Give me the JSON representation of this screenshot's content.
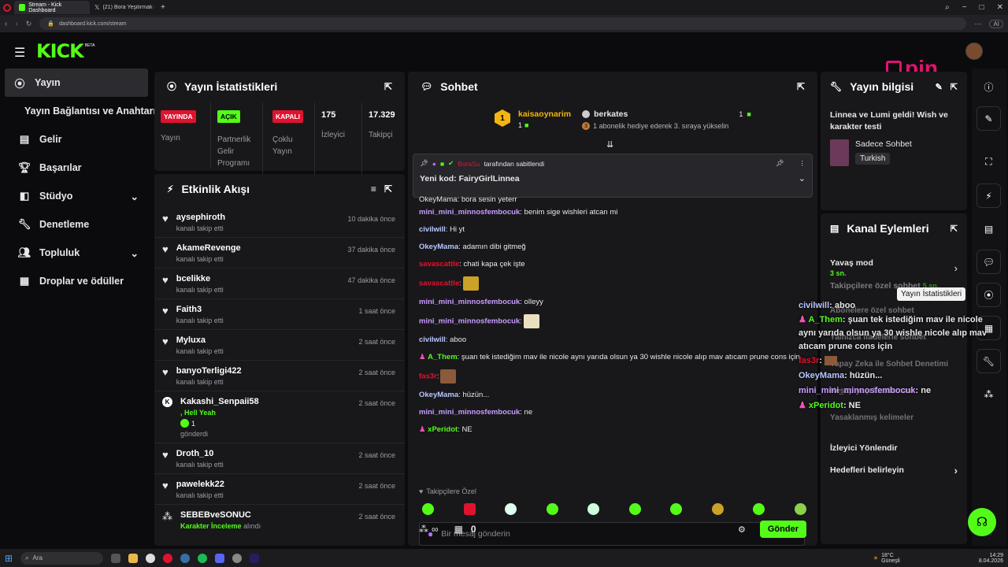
{
  "browser": {
    "tabs": [
      {
        "label": "Stream - Kick Dashboard"
      },
      {
        "label": "(21) Bora Yeşilırmak (@Bo"
      }
    ],
    "url": "dashboard.kick.com/stream"
  },
  "header": {
    "logo": "KICK",
    "logo_tag": "BETA",
    "watermark": "pin"
  },
  "sidebar": {
    "items": [
      {
        "label": "Yayın",
        "icon": "broadcast-icon"
      },
      {
        "label": "Yayın Bağlantısı ve Anahtarı"
      },
      {
        "label": "Gelir",
        "icon": "chart-icon"
      },
      {
        "label": "Başarılar",
        "icon": "trophy-icon"
      },
      {
        "label": "Stüdyo",
        "icon": "studio-icon"
      },
      {
        "label": "Denetleme",
        "icon": "wrench-icon"
      },
      {
        "label": "Topluluk",
        "icon": "community-icon"
      },
      {
        "label": "Droplar ve ödüller",
        "icon": "drops-icon"
      }
    ]
  },
  "stats": {
    "title": "Yayın İstatistikleri",
    "cols": [
      {
        "badge": "YAYINDA",
        "label": "Yayın",
        "color": "#e0132f"
      },
      {
        "badge": "AÇIK",
        "label": "Partnerlik Gelir Programı",
        "color": "#53fc18"
      },
      {
        "badge": "KAPALI",
        "label": "Çoklu Yayın",
        "color": "#e0132f"
      },
      {
        "value": "175",
        "label": "İzleyici"
      },
      {
        "value": "17.329",
        "label": "Takipçi"
      }
    ]
  },
  "activity": {
    "title": "Etkinlik Akışı",
    "items": [
      {
        "name": "aysephiroth",
        "sub": "kanalı takip etti",
        "time": "10 dakika önce"
      },
      {
        "name": "AkameRevenge",
        "sub": "kanalı takip etti",
        "time": "37 dakika önce"
      },
      {
        "name": "bcelikke",
        "sub": "kanalı takip etti",
        "time": "47 dakika önce"
      },
      {
        "name": "Faith3",
        "sub": "kanalı takip etti",
        "time": "1 saat önce"
      },
      {
        "name": "Myluxa",
        "sub": "kanalı takip etti",
        "time": "2 saat önce"
      },
      {
        "name": "banyoTerligi422",
        "sub": "kanalı takip etti",
        "time": "2 saat önce"
      },
      {
        "name": "Kakashi_Senpaii58",
        "msg": ", Hell Yeah",
        "count": "1",
        "sub": "gönderdi",
        "time": "2 saat önce"
      },
      {
        "name": "Droth_10",
        "sub": "kanalı takip etti",
        "time": "2 saat önce"
      },
      {
        "name": "pawelekk22",
        "sub": "kanalı takip etti",
        "time": "2 saat önce"
      },
      {
        "name": "SEBEBveSONUC",
        "reward": "Karakter İnceleme",
        "sub": "alındı",
        "time": "2 saat önce"
      }
    ]
  },
  "chat": {
    "title": "Sohbet",
    "top_gifter": {
      "name": "kaisaoynarim",
      "count": "1",
      "rank": "1"
    },
    "second": {
      "name": "berkates",
      "count": "1",
      "note": "1 abonelik hediye ederek 3. sıraya yükselin",
      "rank": "3"
    },
    "pinned": {
      "by_user": "BoraSu",
      "by_text": "tarafından sabitlendi",
      "text": "Yeni kod: FairyGirlLinnea"
    },
    "cut_line": "OkeyMama: bora sesin yeterr",
    "messages": [
      {
        "user": "mini_mini_minnosfembocuk",
        "color": "#c99cff",
        "text": ": benim sige wishleri atcan mi"
      },
      {
        "user": "civilwill",
        "color": "#b7c7ff",
        "text": ": Hi yt"
      },
      {
        "user": "OkeyMama",
        "color": "#b7c7ff",
        "text": ": adamın dibi gitmeğ"
      },
      {
        "user": "savascattle",
        "color": "#e0132f",
        "text": ": chati kapa çek işte"
      },
      {
        "user": "savascattle",
        "color": "#e0132f",
        "text": ":",
        "emote": "#c9a227"
      },
      {
        "user": "mini_mini_minnosfembocuk",
        "color": "#c99cff",
        "text": ": olleyy"
      },
      {
        "user": "mini_mini_minnosfembocuk",
        "color": "#c99cff",
        "text": ":",
        "emote": "#e8e0c0"
      },
      {
        "user": "civilwill",
        "color": "#b7c7ff",
        "text": ": aboo"
      },
      {
        "user": "A_Them",
        "color": "#53fc18",
        "text": ": şuan tek istediğim mav ile nicole aynı yarıda olsun ya 30 wishle nicole alıp mav atıcam prune cons için",
        "badge": true
      },
      {
        "user": "fas3r",
        "color": "#e0132f",
        "text": ":",
        "emote": "#8a5a3a"
      },
      {
        "user": "OkeyMama",
        "color": "#b7c7ff",
        "text": ": hüzün..."
      },
      {
        "user": "mini_mini_minnosfembocuk",
        "color": "#c99cff",
        "text": ": ne"
      },
      {
        "user": "xPeridot",
        "color": "#53fc18",
        "text": ": NE",
        "badge": true
      }
    ],
    "followers_only": "Takipçilere Özel",
    "input_placeholder": "Bir mesaj gönderin",
    "points": "0",
    "send": "Gönder",
    "infinity": "∞"
  },
  "info": {
    "title": "Yayın bilgisi",
    "stream_title": "Linnea ve Lumi geldi! Wish ve karakter testi",
    "category": "Sadece Sohbet",
    "language": "Turkish"
  },
  "channel": {
    "title": "Kanal Eylemleri",
    "rows": [
      {
        "label": "Yavaş mod",
        "value": "3 sn."
      },
      {
        "label": "Takipçilere özel sohbet",
        "value": "5 sn."
      },
      {
        "label": "Abonelere özel sohbet"
      },
      {
        "label": "Yalnızca ifadelerle sohbet"
      },
      {
        "label": "Yapay Zeka ile Sohbet Denetimi"
      },
      {
        "label": "Hesap yaşı kısıtlaması"
      },
      {
        "label": "Yasaklanmış kelimeler"
      },
      {
        "label": "İzleyici Yönlendir"
      },
      {
        "label": "Hedefleri belirleyin"
      }
    ]
  },
  "tooltip": "Yayın İstatistikleri",
  "overlay": [
    {
      "user": "civilwill",
      "text": ": aboo",
      "color": "#b7c7ff"
    },
    {
      "user": "A_Them",
      "text": ": şuan tek istediğim mav ile nicole aynı yarıda olsun ya 30 wishle nicole alıp mav atıcam prune cons için",
      "color": "#53fc18"
    },
    {
      "user": "fas3r",
      "text": ":",
      "color": "#e0132f"
    },
    {
      "user": "OkeyMama",
      "text": ": hüzün...",
      "color": "#b7c7ff"
    },
    {
      "user": "mini_mini_minnosfembocuk",
      "text": ": ne",
      "color": "#c99cff"
    },
    {
      "user": "xPeridot",
      "text": ": NE",
      "color": "#53fc18"
    }
  ],
  "taskbar": {
    "search": "Ara",
    "weather_temp": "18°C",
    "weather_desc": "Güneşli",
    "time": "14:29",
    "date": "8.04.2026"
  }
}
